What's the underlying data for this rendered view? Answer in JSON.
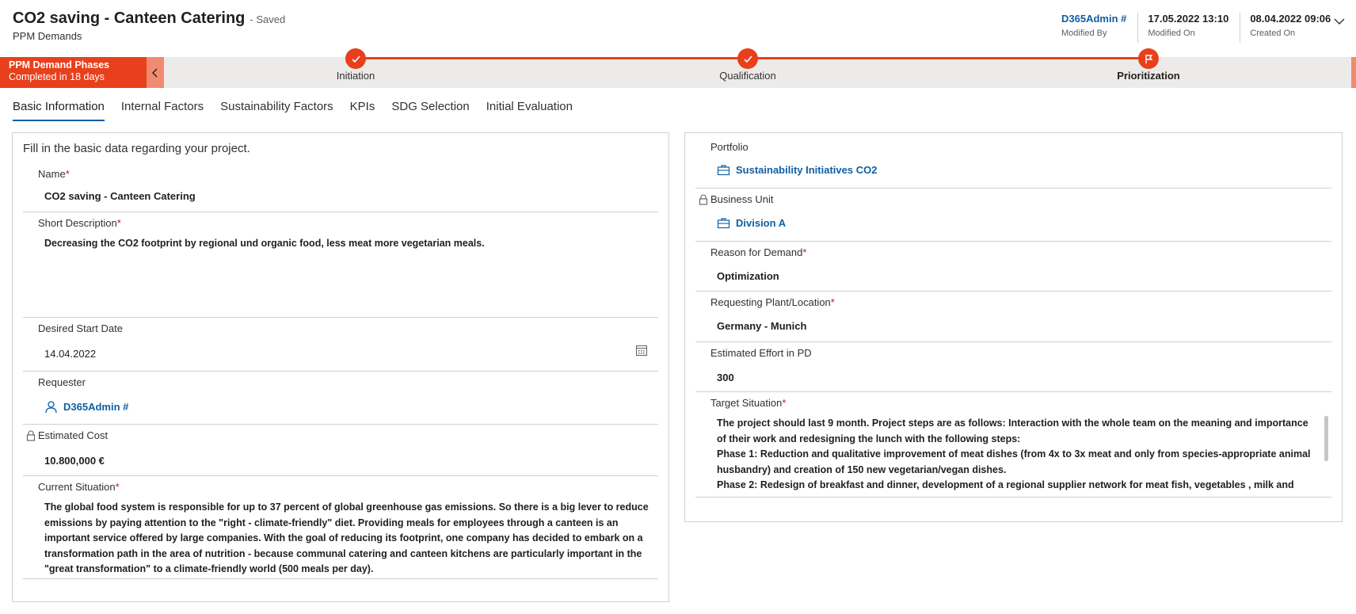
{
  "header": {
    "title": "CO2 saving - Canteen Catering",
    "saved": "- Saved",
    "entity": "PPM Demands",
    "fields": [
      {
        "value": "D365Admin #",
        "label": "Modified By"
      },
      {
        "value": "17.05.2022 13:10",
        "label": "Modified On"
      },
      {
        "value": "08.04.2022 09:06",
        "label": "Created On"
      }
    ]
  },
  "process": {
    "stage_title": "PPM Demand Phases",
    "stage_sub": "Completed in 18 days",
    "stages": [
      {
        "label": "Initiation",
        "state": "completed",
        "icon": "check-icon"
      },
      {
        "label": "Qualification",
        "state": "completed",
        "icon": "check-icon"
      },
      {
        "label": "Prioritization",
        "state": "active",
        "icon": "flag-icon"
      }
    ],
    "accent": "#e8401c"
  },
  "tabs": [
    "Basic Information",
    "Internal Factors",
    "Sustainability Factors",
    "KPIs",
    "SDG Selection",
    "Initial Evaluation"
  ],
  "left": {
    "description": "Fill in the basic data regarding your project.",
    "name_label": "Name",
    "name_value": "CO2 saving - Canteen Catering",
    "short_desc_label": "Short Description",
    "short_desc_value": "Decreasing the CO2 footprint by regional und organic food, less meat more vegetarian meals.",
    "start_date_label": "Desired Start Date",
    "start_date_value": "14.04.2022",
    "requester_label": "Requester",
    "requester_value": "D365Admin #",
    "cost_label": "Estimated Cost",
    "cost_value": "10.800,000 €",
    "current_label": "Current Situation",
    "current_value": "The global food system is responsible for up to 37 percent of global greenhouse gas emissions. So there is a big lever to reduce emissions by paying attention to the \"right - climate-friendly\" diet. Providing meals for employees through a canteen is an important service offered by large companies. With the goal of reducing its footprint, one company has decided to embark on a transformation path in the area of nutrition - because communal catering and canteen kitchens are particularly important in the \"great transformation\" to a climate-friendly world (500 meals per day)."
  },
  "right": {
    "portfolio_label": "Portfolio",
    "portfolio_value": "Sustainability Initiatives CO2",
    "bu_label": "Business Unit",
    "bu_value": "Division A",
    "reason_label": "Reason for Demand",
    "reason_value": "Optimization",
    "plant_label": "Requesting Plant/Location",
    "plant_value": "Germany - Munich",
    "effort_label": "Estimated Effort in PD",
    "effort_value": "300",
    "target_label": "Target Situation",
    "target_p1": "The project should last 9 month. Project steps are as follows: Interaction with the whole team on the meaning and importance of their work and redesigning the lunch with the following steps:",
    "target_p2": "Phase 1: Reduction and qualitative improvement of meat dishes (from 4x to 3x meat and only from species-appropriate animal husbandry) and creation of 150 new vegetarian/vegan dishes.",
    "target_p3": "Phase 2: Redesign of breakfast and dinner, development of a regional supplier network for meat fish, vegetables , milk and"
  }
}
